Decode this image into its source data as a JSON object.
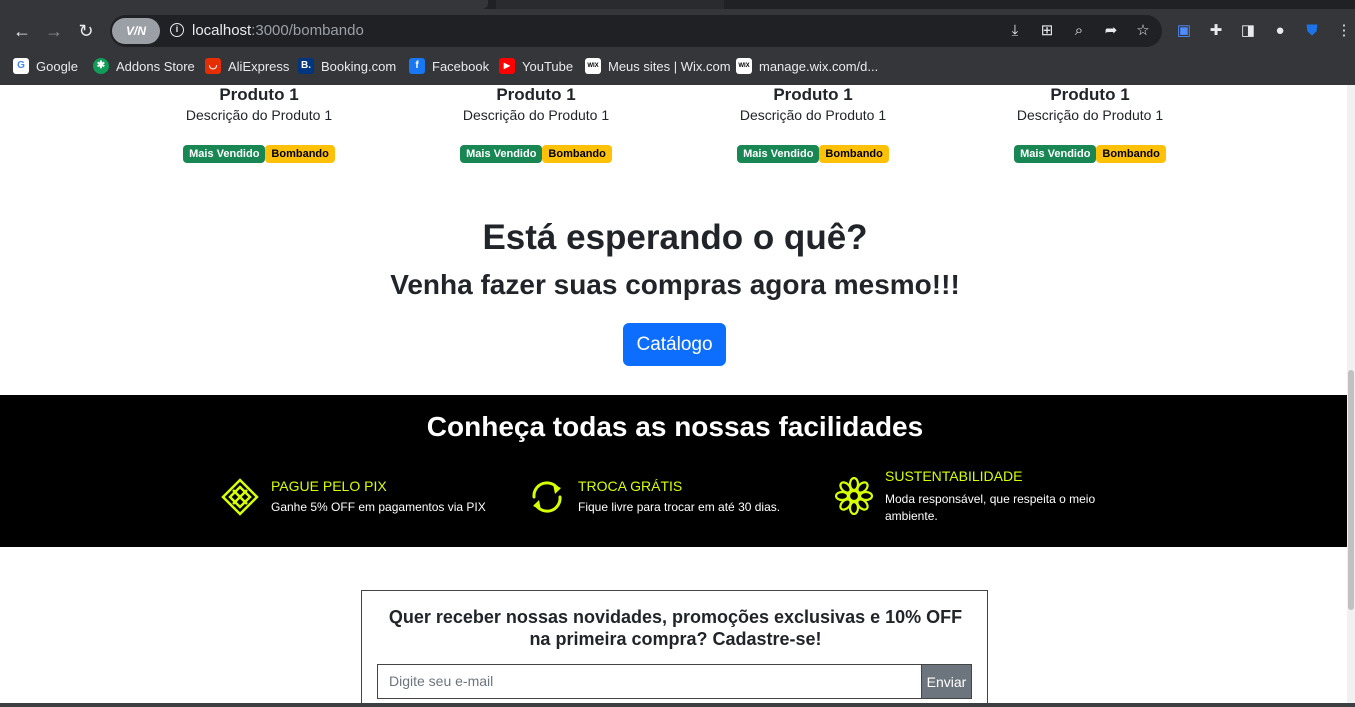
{
  "browser": {
    "url_host": "localhost",
    "url_path": ":3000/bombando",
    "vpn_label": "V/N",
    "bookmarks": [
      {
        "label": "Google",
        "icon": "google-icon",
        "badge": "G",
        "color": "#ffffff"
      },
      {
        "label": "Addons Store",
        "icon": "addons-store-icon",
        "badge": "✱",
        "color": "#0f9d58"
      },
      {
        "label": "AliExpress",
        "icon": "aliexpress-icon",
        "badge": "◡",
        "color": "#e62e04"
      },
      {
        "label": "Booking.com",
        "icon": "booking-icon",
        "badge": "B.",
        "color": "#003580"
      },
      {
        "label": "Facebook",
        "icon": "facebook-icon",
        "badge": "f",
        "color": "#1877f2"
      },
      {
        "label": "YouTube",
        "icon": "youtube-icon",
        "badge": "▶",
        "color": "#ff0000"
      },
      {
        "label": "Meus sites | Wix.com",
        "icon": "wix-icon",
        "badge": "WIX",
        "color": "#ffffff"
      },
      {
        "label": "manage.wix.com/d...",
        "icon": "wix-icon",
        "badge": "WIX",
        "color": "#ffffff"
      }
    ]
  },
  "products": [
    {
      "name": "Produto 1",
      "description": "Descrição do Produto 1",
      "badges": [
        "Mais Vendido",
        "Bombando"
      ]
    },
    {
      "name": "Produto 1",
      "description": "Descrição do Produto 1",
      "badges": [
        "Mais Vendido",
        "Bombando"
      ]
    },
    {
      "name": "Produto 1",
      "description": "Descrição do Produto 1",
      "badges": [
        "Mais Vendido",
        "Bombando"
      ]
    },
    {
      "name": "Produto 1",
      "description": "Descrição do Produto 1",
      "badges": [
        "Mais Vendido",
        "Bombando"
      ]
    }
  ],
  "cta": {
    "title": "Está esperando o quê?",
    "subtitle": "Venha fazer suas compras agora mesmo!!!",
    "button": "Catálogo"
  },
  "facilities": {
    "title": "Conheça todas as nossas facilidades",
    "accent": "#d7ff00",
    "items": [
      {
        "title": "PAGUE PELO PIX",
        "description": "Ganhe 5% OFF em pagamentos via PIX",
        "icon": "pix-icon"
      },
      {
        "title": "TROCA GRÁTIS",
        "description": "Fique livre para trocar em até 30 dias.",
        "icon": "refresh-icon"
      },
      {
        "title": "SUSTENTABILIDADE",
        "description": "Moda responsável, que respeita o meio ambiente.",
        "icon": "flower-icon"
      }
    ]
  },
  "newsletter": {
    "title": "Quer receber nossas novidades, promoções exclusivas e 10% OFF na primeira compra? Cadastre-se!",
    "placeholder": "Digite seu e-mail",
    "button": "Enviar"
  }
}
